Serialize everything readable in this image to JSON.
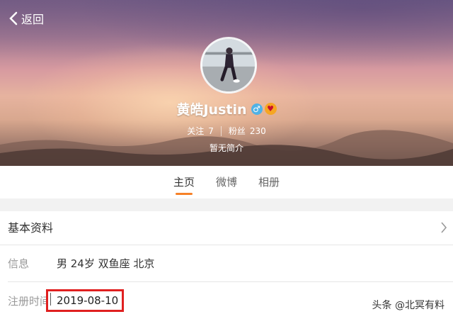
{
  "nav": {
    "back_label": "返回"
  },
  "profile": {
    "name": "黄皓Justin",
    "following_label": "关注",
    "following_count": "7",
    "followers_label": "粉丝",
    "followers_count": "230",
    "bio": "暂无简介"
  },
  "tabs": [
    {
      "label": "主页",
      "active": true
    },
    {
      "label": "微博",
      "active": false
    },
    {
      "label": "相册",
      "active": false
    }
  ],
  "info_card": {
    "title": "基本资料",
    "info_label": "信息",
    "info_value": "男 24岁 双鱼座 北京",
    "reg_label": "注册时间",
    "reg_value": "2019-08-10"
  },
  "watermark": "头条 @北冥有料",
  "colors": {
    "tab_indicator": "#f68128",
    "highlight_border": "#e02020",
    "male_badge": "#4fb2e6"
  }
}
